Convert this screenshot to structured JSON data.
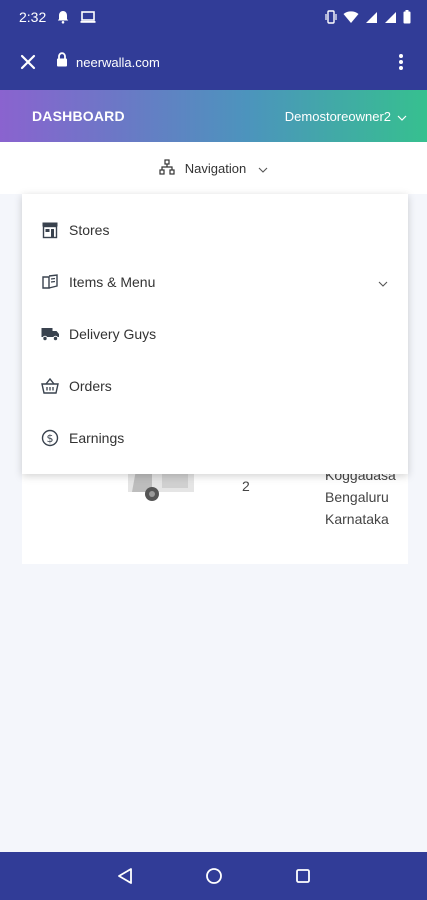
{
  "status_bar": {
    "time": "2:32",
    "left_icons": [
      "bell-icon",
      "laptop-icon"
    ],
    "right_icons": [
      "vibrate-icon",
      "wifi-icon",
      "signal-icon",
      "signal-icon",
      "battery-icon"
    ]
  },
  "browser": {
    "domain": "neerwalla.com",
    "icons": [
      "close-icon",
      "lock-icon",
      "more-vert-icon"
    ]
  },
  "header": {
    "title": "DASHBOARD",
    "user": "Demostoreowner2",
    "gradient": [
      "#8a63cf",
      "#36c08f"
    ]
  },
  "nav": {
    "label": "Navigation",
    "icon": "sitemap-icon"
  },
  "menu": {
    "items": [
      {
        "label": "Stores",
        "icon": "store-icon"
      },
      {
        "label": "Items & Menu",
        "icon": "menu-book-icon",
        "has_submenu": true
      },
      {
        "label": "Delivery Guys",
        "icon": "truck-icon"
      },
      {
        "label": "Orders",
        "icon": "basket-icon"
      },
      {
        "label": "Earnings",
        "icon": "dollar-circle-icon"
      }
    ]
  },
  "background_content": {
    "count": "2",
    "address_lines": [
      "Koggadasa",
      "Bengaluru",
      "Karnataka"
    ]
  },
  "colors": {
    "primary": "#313c97",
    "background": "#f4f6fb"
  }
}
